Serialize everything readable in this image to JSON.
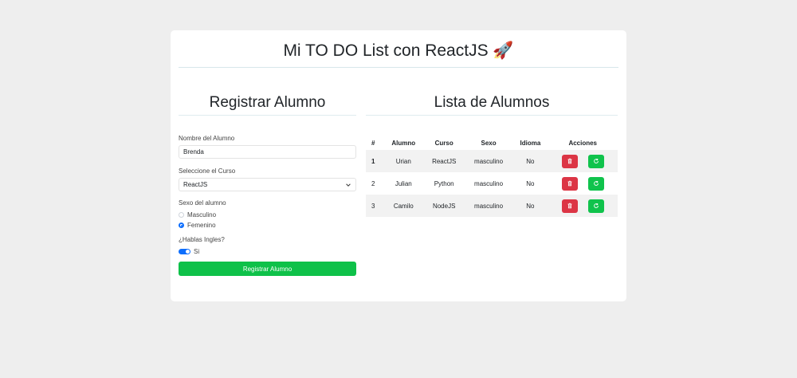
{
  "header": {
    "title": "Mi TO DO List con ReactJS 🚀"
  },
  "form": {
    "title": "Registrar Alumno",
    "name_label": "Nombre del Alumno",
    "name_value": "Brenda",
    "course_label": "Seleccione el Curso",
    "course_value": "ReactJS",
    "sex_label": "Sexo del alumno",
    "sex_options": [
      "Masculino",
      "Femenino"
    ],
    "sex_selected": "Femenino",
    "english_label": "¿Hablas Ingles?",
    "english_toggle_label": "Si",
    "english_on": true,
    "submit_label": "Registrar Alumno"
  },
  "list": {
    "title": "Lista de Alumnos",
    "columns": [
      "#",
      "Alumno",
      "Curso",
      "Sexo",
      "Idioma",
      "Acciones"
    ],
    "rows": [
      {
        "num": "1",
        "alumno": "Urian",
        "curso": "ReactJS",
        "sexo": "masculino",
        "idioma": "No"
      },
      {
        "num": "2",
        "alumno": "Julian",
        "curso": "Python",
        "sexo": "masculino",
        "idioma": "No"
      },
      {
        "num": "3",
        "alumno": "Camilo",
        "curso": "NodeJS",
        "sexo": "masculino",
        "idioma": "No"
      }
    ]
  },
  "colors": {
    "primary": "#0d6efd",
    "success": "#0ec149",
    "danger": "#dc3545",
    "background": "#eeeeee"
  },
  "icons": {
    "delete": "trash-icon",
    "update": "refresh-icon"
  }
}
